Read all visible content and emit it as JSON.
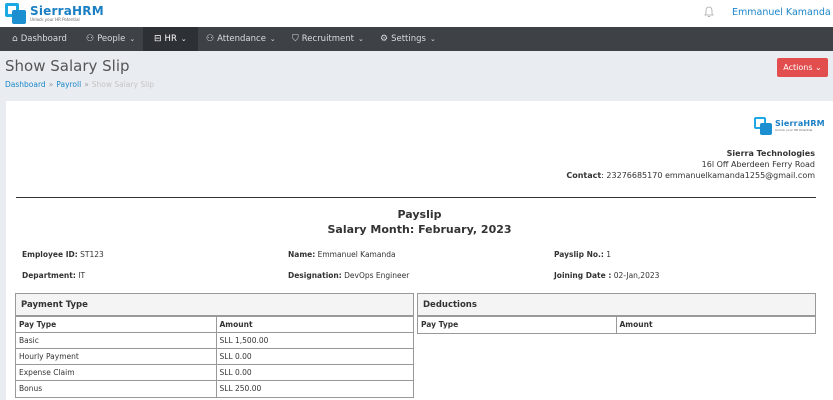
{
  "brand": {
    "name": "SierraHRM",
    "tagline": "Unlock your HR Potential"
  },
  "topbar": {
    "user_name": "Emmanuel Kamanda"
  },
  "nav": [
    {
      "label": "Dashboard",
      "icon": "home-icon",
      "glyph": "⌂"
    },
    {
      "label": "People",
      "icon": "person-icon",
      "glyph": "⚇",
      "chevron": "⌄"
    },
    {
      "label": "HR",
      "icon": "briefcase-icon",
      "glyph": "⊟",
      "chevron": "⌄"
    },
    {
      "label": "Attendance",
      "icon": "attendance-icon",
      "glyph": "⚇",
      "chevron": "⌄"
    },
    {
      "label": "Recruitment",
      "icon": "graduation-cap-icon",
      "glyph": "⛉",
      "chevron": "⌄"
    },
    {
      "label": "Settings",
      "icon": "gear-icon",
      "glyph": "⚙",
      "chevron": "⌄"
    }
  ],
  "page": {
    "title": "Show Salary Slip",
    "breadcrumb": [
      "Dashboard",
      "Payroll",
      "Show Salary Slip"
    ],
    "breadcrumb_sep": "»",
    "actions_label": "Actions ⌄"
  },
  "company": {
    "name": "Sierra Technologies",
    "address": "16l Off Aberdeen Ferry Road",
    "contact_label": "Contact",
    "contact_value": ": 23276685170 emmanuelkamanda1255@gmail.com"
  },
  "payslip": {
    "title": "Payslip",
    "month": "Salary Month: February, 2023",
    "employee_id_label": "Employee ID:",
    "employee_id": " ST123",
    "name_label": "Name:",
    "name": " Emmanuel Kamanda",
    "payslip_no_label": "Payslip No.:",
    "payslip_no": " 1",
    "department_label": "Department:",
    "department": " IT",
    "designation_label": "Designation:",
    "designation": " DevOps Engineer",
    "joining_label": "Joining Date :",
    "joining": " 02-Jan,2023"
  },
  "payments": {
    "heading": "Payment Type",
    "col_type": "Pay Type",
    "col_amount": "Amount",
    "rows": [
      {
        "type": "Basic",
        "amount": "SLL 1,500.00"
      },
      {
        "type": "Hourly Payment",
        "amount": "SLL 0.00"
      },
      {
        "type": "Expense Claim",
        "amount": "SLL 0.00"
      },
      {
        "type": "Bonus",
        "amount": "SLL 250.00"
      }
    ]
  },
  "deductions": {
    "heading": "Deductions",
    "col_type": "Pay Type",
    "col_amount": "Amount"
  }
}
